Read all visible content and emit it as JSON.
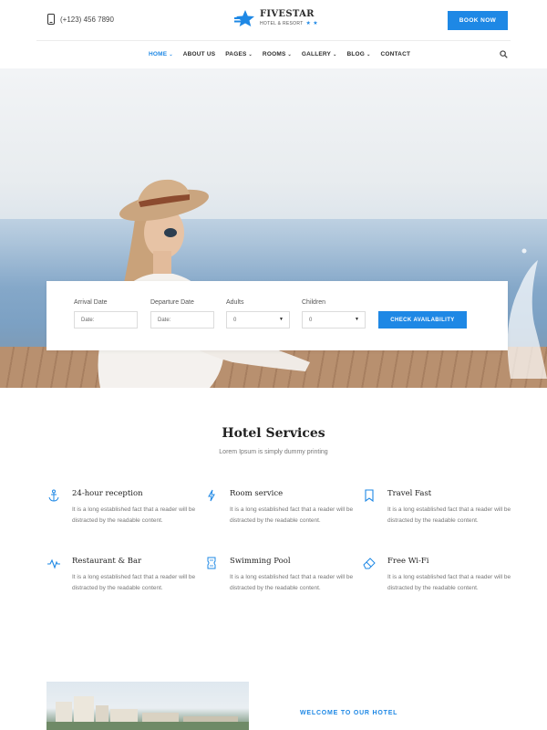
{
  "header": {
    "phone": "(+123) 456 7890",
    "logo_name": "FIVESTAR",
    "logo_tagline": "HOTEL & RESORT",
    "logo_stars": "★ ★",
    "book_button": "BOOK NOW"
  },
  "nav": {
    "items": [
      {
        "label": "HOME",
        "dropdown": true,
        "active": true
      },
      {
        "label": "ABOUT US",
        "dropdown": false
      },
      {
        "label": "PAGES",
        "dropdown": true
      },
      {
        "label": "ROOMS",
        "dropdown": true
      },
      {
        "label": "GALLERY",
        "dropdown": true
      },
      {
        "label": "BLOG",
        "dropdown": true
      },
      {
        "label": "CONTACT",
        "dropdown": false
      }
    ],
    "caret": "⌄"
  },
  "booking": {
    "arrival_label": "Arrival Date",
    "arrival_placeholder": "Date:",
    "departure_label": "Departure Date",
    "departure_placeholder": "Date:",
    "adults_label": "Adults",
    "adults_value": "0",
    "children_label": "Children",
    "children_value": "0",
    "select_arrow": "▼",
    "submit": "CHECK AVAILABILITY"
  },
  "services": {
    "title": "Hotel Services",
    "subtitle": "Lorem Ipsum is simply dummy printing",
    "items": [
      {
        "title": "24-hour reception",
        "icon": "anchor-icon",
        "desc": "It is a long established fact that a reader will be distracted by the readable content."
      },
      {
        "title": "Room service",
        "icon": "bolt-icon",
        "desc": "It is a long established fact that a reader will be distracted by the readable content."
      },
      {
        "title": "Travel Fast",
        "icon": "bookmark-icon",
        "desc": "It is a long established fact that a reader will be distracted by the readable content."
      },
      {
        "title": "Restaurant & Bar",
        "icon": "pulse-icon",
        "desc": "It is a long established fact that a reader will be distracted by the readable content."
      },
      {
        "title": "Swimming Pool",
        "icon": "ticket-icon",
        "desc": "It is a long established fact that a reader will be distracted by the readable content."
      },
      {
        "title": "Free Wi-Fi",
        "icon": "eraser-icon",
        "desc": "It is a long established fact that a reader will be distracted by the readable content."
      }
    ]
  },
  "welcome": {
    "label": "WELCOME TO OUR HOTEL"
  },
  "colors": {
    "accent": "#1e88e5"
  }
}
